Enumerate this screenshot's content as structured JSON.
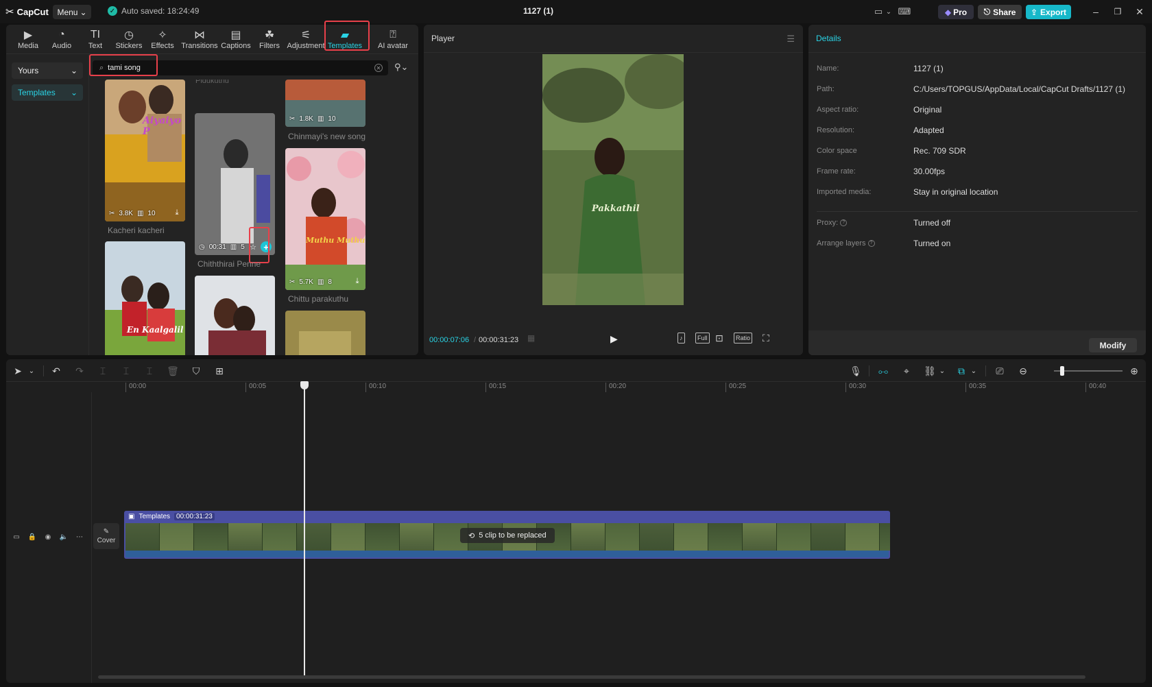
{
  "titlebar": {
    "logo": "CapCut",
    "menu_label": "Menu",
    "autosave": "Auto saved: 18:24:49",
    "project_title": "1127 (1)",
    "pro_label": "Pro",
    "share_label": "Share",
    "export_label": "Export"
  },
  "tool_tabs": [
    {
      "label": "Media",
      "icon": "media-icon"
    },
    {
      "label": "Audio",
      "icon": "audio-icon"
    },
    {
      "label": "Text",
      "icon": "text-icon"
    },
    {
      "label": "Stickers",
      "icon": "stickers-icon"
    },
    {
      "label": "Effects",
      "icon": "effects-icon"
    },
    {
      "label": "Transitions",
      "icon": "transitions-icon"
    },
    {
      "label": "Captions",
      "icon": "captions-icon"
    },
    {
      "label": "Filters",
      "icon": "filters-icon"
    },
    {
      "label": "Adjustment",
      "icon": "adjustment-icon"
    },
    {
      "label": "Templates",
      "icon": "templates-icon",
      "active": true
    },
    {
      "label": "AI avatar",
      "icon": "avatar-icon"
    }
  ],
  "sidebar": {
    "yours_label": "Yours",
    "templates_label": "Templates"
  },
  "search": {
    "value": "tami song"
  },
  "templates": [
    {
      "name": "Kacheri kacheri",
      "uses": "3.8K",
      "clips": "10",
      "overlay": "Aiyaiyo P"
    },
    {
      "name": "Chiththirai Penne",
      "duration": "00:31",
      "clips": "5"
    },
    {
      "name": "Chinmayi's new song",
      "uses": "1.8K",
      "clips": "10"
    },
    {
      "name": "Chittu parakuthu",
      "uses": "5.7K",
      "clips": "8",
      "overlay": "Muthu Muthu"
    },
    {
      "name": "",
      "overlay": "En Kaalgalil"
    },
    {
      "name": ""
    },
    {
      "name": ""
    }
  ],
  "partial_label_top": "Pidukuthu",
  "player": {
    "title": "Player",
    "current_time": "00:00:07:06",
    "total_time": "00:00:31:23",
    "overlay_text": "Pakkathil",
    "full_label": "Full",
    "ratio_label": "Ratio"
  },
  "details": {
    "title": "Details",
    "rows": [
      {
        "key": "Name:",
        "value": "1127 (1)"
      },
      {
        "key": "Path:",
        "value": "C:/Users/TOPGUS/AppData/Local/CapCut Drafts/1127 (1)"
      },
      {
        "key": "Aspect ratio:",
        "value": "Original"
      },
      {
        "key": "Resolution:",
        "value": "Adapted"
      },
      {
        "key": "Color space",
        "value": "Rec. 709 SDR"
      },
      {
        "key": "Frame rate:",
        "value": "30.00fps"
      },
      {
        "key": "Imported media:",
        "value": "Stay in original location"
      }
    ],
    "rows2": [
      {
        "key": "Proxy:",
        "value": "Turned off"
      },
      {
        "key": "Arrange layers",
        "value": "Turned on"
      }
    ],
    "modify_label": "Modify"
  },
  "timeline": {
    "ruler": [
      "00:00",
      "00:05",
      "00:10",
      "00:15",
      "00:20",
      "00:25",
      "00:30",
      "00:35",
      "00:40"
    ],
    "cover_label": "Cover",
    "clip_label": "Templates",
    "clip_duration": "00:00:31:23",
    "replace_badge": "5 clip to be replaced"
  },
  "colors": {
    "accent": "#2ad4e6",
    "export": "#17b8c9",
    "highlight": "#e8404a",
    "clip": "#4a4fa3"
  }
}
